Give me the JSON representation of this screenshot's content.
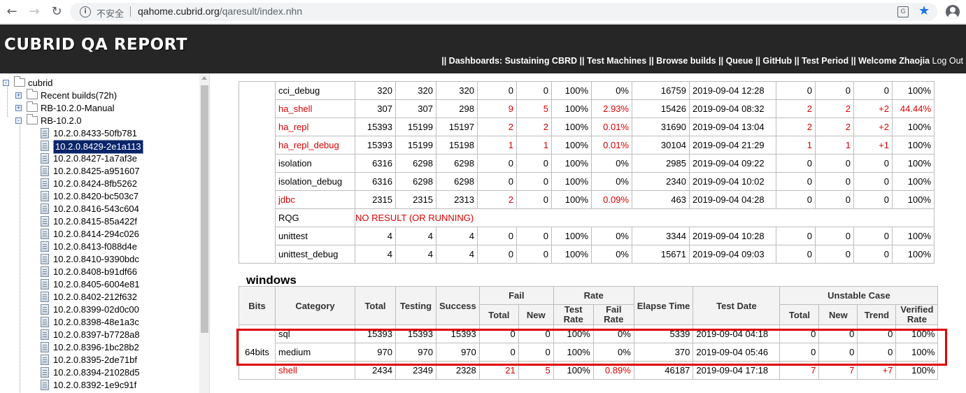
{
  "browser": {
    "insecure_label": "不安全",
    "url_host": "qahome.cubrid.org",
    "url_path": "/qaresult/index.nhn"
  },
  "header": {
    "logo": "CUBRID QA REPORT",
    "nav": {
      "prefix": "|| Dashboards:",
      "items": [
        "Sustaining CBRD",
        "Test Machines",
        "Browse builds",
        "Queue",
        "GitHub",
        "Test Period"
      ],
      "welcome": "Welcome Zhaojia",
      "logout": "Log Out"
    }
  },
  "sidebar": {
    "root": "cubrid",
    "folders": [
      "Recent builds(72h)",
      "RB-10.2.0-Manual",
      "RB-10.2.0"
    ],
    "builds": [
      "10.2.0.8433-50fb781",
      "10.2.0.8429-2e1a113",
      "10.2.0.8427-1a7af3e",
      "10.2.0.8425-a951607",
      "10.2.0.8424-8fb5262",
      "10.2.0.8420-bc503c7",
      "10.2.0.8416-543c604",
      "10.2.0.8415-85a422f",
      "10.2.0.8414-294c026",
      "10.2.0.8413-f088d4e",
      "10.2.0.8410-9390bdc",
      "10.2.0.8408-b91df66",
      "10.2.0.8405-6004e81",
      "10.2.0.8402-212f632",
      "10.2.0.8399-02d0c00",
      "10.2.0.8398-48e1a3c",
      "10.2.0.8397-b7728a8",
      "10.2.0.8396-1bc28b2",
      "10.2.0.8395-2de71bf",
      "10.2.0.8394-21028d5",
      "10.2.0.8392-1e9c91f"
    ],
    "selected_index": 1
  },
  "linux_rows": [
    {
      "category": "cci_debug",
      "red": false,
      "total": "320",
      "testing": "320",
      "success": "320",
      "fail_total": "0",
      "fail_new": "0",
      "test_rate": "100%",
      "fail_rate": "0%",
      "elapse": "16759",
      "date": "2019-09-04 12:28",
      "u_total": "0",
      "u_new": "0",
      "u_trend": "0",
      "v_rate": "100%"
    },
    {
      "category": "ha_shell",
      "red": true,
      "total": "307",
      "testing": "307",
      "success": "298",
      "fail_total": "9",
      "fail_new": "5",
      "test_rate": "100%",
      "fail_rate": "2.93%",
      "elapse": "15426",
      "date": "2019-09-04 08:32",
      "u_total": "2",
      "u_new": "2",
      "u_trend": "+2",
      "v_rate": "44.44%"
    },
    {
      "category": "ha_repl",
      "red": true,
      "total": "15393",
      "testing": "15199",
      "success": "15197",
      "fail_total": "2",
      "fail_new": "2",
      "test_rate": "100%",
      "fail_rate": "0.01%",
      "elapse": "31690",
      "date": "2019-09-04 13:04",
      "u_total": "2",
      "u_new": "2",
      "u_trend": "+2",
      "v_rate": "100%"
    },
    {
      "category": "ha_repl_debug",
      "red": true,
      "total": "15393",
      "testing": "15199",
      "success": "15198",
      "fail_total": "1",
      "fail_new": "1",
      "test_rate": "100%",
      "fail_rate": "0.01%",
      "elapse": "30104",
      "date": "2019-09-04 21:29",
      "u_total": "1",
      "u_new": "1",
      "u_trend": "+1",
      "v_rate": "100%"
    },
    {
      "category": "isolation",
      "red": false,
      "total": "6316",
      "testing": "6298",
      "success": "6298",
      "fail_total": "0",
      "fail_new": "0",
      "test_rate": "100%",
      "fail_rate": "0%",
      "elapse": "2985",
      "date": "2019-09-04 09:22",
      "u_total": "0",
      "u_new": "0",
      "u_trend": "0",
      "v_rate": "100%"
    },
    {
      "category": "isolation_debug",
      "red": false,
      "total": "6316",
      "testing": "6298",
      "success": "6298",
      "fail_total": "0",
      "fail_new": "0",
      "test_rate": "100%",
      "fail_rate": "0%",
      "elapse": "2340",
      "date": "2019-09-04 10:02",
      "u_total": "0",
      "u_new": "0",
      "u_trend": "0",
      "v_rate": "100%"
    },
    {
      "category": "jdbc",
      "red": true,
      "total": "2315",
      "testing": "2315",
      "success": "2313",
      "fail_total": "2",
      "fail_new": "0",
      "test_rate": "100%",
      "fail_rate": "0.09%",
      "elapse": "463",
      "date": "2019-09-04 04:28",
      "u_total": "0",
      "u_new": "0",
      "u_trend": "0",
      "v_rate": "100%"
    },
    {
      "category": "RQG",
      "red": false,
      "no_result": "NO RESULT (OR RUNNING)"
    },
    {
      "category": "unittest",
      "red": false,
      "total": "4",
      "testing": "4",
      "success": "4",
      "fail_total": "0",
      "fail_new": "0",
      "test_rate": "100%",
      "fail_rate": "0%",
      "elapse": "3344",
      "date": "2019-09-04 10:28",
      "u_total": "0",
      "u_new": "0",
      "u_trend": "0",
      "v_rate": "100%"
    },
    {
      "category": "unittest_debug",
      "red": false,
      "total": "4",
      "testing": "4",
      "success": "4",
      "fail_total": "0",
      "fail_new": "0",
      "test_rate": "100%",
      "fail_rate": "0%",
      "elapse": "15671",
      "date": "2019-09-04 09:03",
      "u_total": "0",
      "u_new": "0",
      "u_trend": "0",
      "v_rate": "100%"
    }
  ],
  "windows": {
    "title": "windows",
    "headers": {
      "bits": "Bits",
      "category": "Category",
      "total": "Total",
      "testing": "Testing",
      "success": "Success",
      "fail": "Fail",
      "rate": "Rate",
      "elapse": "Elapse Time",
      "date": "Test Date",
      "unstable": "Unstable Case",
      "fail_total": "Total",
      "fail_new": "New",
      "test_rate": "Test Rate",
      "fail_rate": "Fail Rate",
      "u_total": "Total",
      "u_new": "New",
      "u_trend": "Trend",
      "v_rate": "Verified Rate"
    },
    "bits": "64bits",
    "rows": [
      {
        "category": "sql",
        "red": false,
        "total": "15393",
        "testing": "15393",
        "success": "15393",
        "fail_total": "0",
        "fail_new": "0",
        "test_rate": "100%",
        "fail_rate": "0%",
        "elapse": "5339",
        "date": "2019-09-04 04:18",
        "u_total": "0",
        "u_new": "0",
        "u_trend": "0",
        "v_rate": "100%"
      },
      {
        "category": "medium",
        "red": false,
        "total": "970",
        "testing": "970",
        "success": "970",
        "fail_total": "0",
        "fail_new": "0",
        "test_rate": "100%",
        "fail_rate": "0%",
        "elapse": "370",
        "date": "2019-09-04 05:46",
        "u_total": "0",
        "u_new": "0",
        "u_trend": "0",
        "v_rate": "100%"
      },
      {
        "category": "shell",
        "red": true,
        "total": "2434",
        "testing": "2349",
        "success": "2328",
        "fail_total": "21",
        "fail_new": "5",
        "test_rate": "100%",
        "fail_rate": "0.89%",
        "elapse": "46187",
        "date": "2019-09-04 17:18",
        "u_total": "7",
        "u_new": "7",
        "u_trend": "+7",
        "v_rate": "100%"
      }
    ]
  },
  "colors": {
    "header_bg": "#262626",
    "fail_red": "#dd0000",
    "highlight": "#e00000",
    "selection": "#0a246a"
  }
}
